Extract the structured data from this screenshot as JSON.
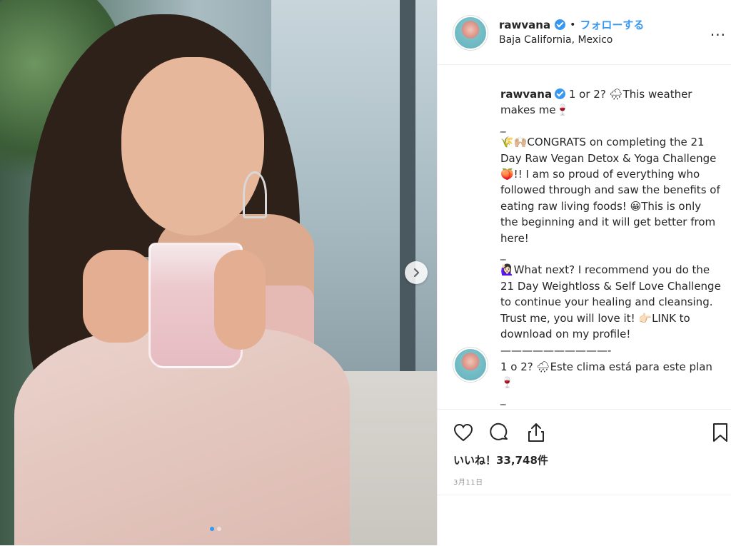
{
  "post": {
    "next_icon": "chevron-right-icon",
    "carousel_total": 2,
    "carousel_active": 1
  },
  "header": {
    "username": "rawvana",
    "separator": "•",
    "follow_label": "フォローする",
    "location": "Baja California, Mexico",
    "more_label": "..."
  },
  "caption": {
    "username": "rawvana",
    "text": " 1 or 2? 🌧This weather makes me🍷\n_\n🌾🙌🏼CONGRATS on completing the 21 Day Raw Vegan Detox & Yoga Challenge🍑!! I am so proud of everything who followed through and saw the benefits of eating raw living foods! 😀This is only the beginning and it will get better from here!\n_\n🙋🏻‍♀️What next? I recommend you do the 21 Day Weightloss & Self Love Challenge to continue your healing and cleansing. Trust me, you will love it! 👉🏻LINK to download on my profile!\n——————————-"
  },
  "comment": {
    "text": "1 o 2? 🌧Este clima está para este plan\n🍷\n_"
  },
  "actions": {
    "likes_label": "いいね！33,748件",
    "date": "3月11日"
  },
  "colors": {
    "accent": "#3897f0",
    "text": "#262626",
    "muted": "#999999",
    "border": "#efefef"
  }
}
